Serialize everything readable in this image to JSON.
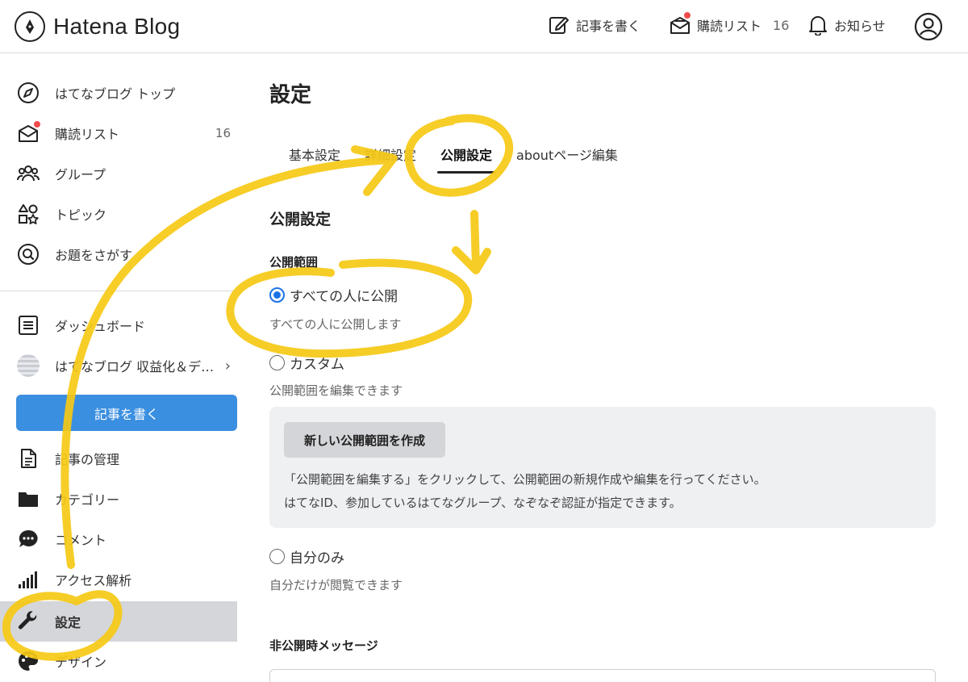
{
  "header": {
    "logo_text": "Hatena Blog",
    "write_label": "記事を書く",
    "reading_list_label": "購読リスト",
    "reading_list_count": "16",
    "notifications_label": "お知らせ"
  },
  "sidebar": {
    "top_items": [
      {
        "label": "はてなブログ トップ",
        "icon": "compass-icon"
      },
      {
        "label": "購読リスト",
        "icon": "reading-list-icon",
        "count": "16"
      },
      {
        "label": "グループ",
        "icon": "group-icon"
      },
      {
        "label": "トピック",
        "icon": "topic-icon"
      },
      {
        "label": "お題をさがす",
        "icon": "search-theme-icon"
      }
    ],
    "dashboard_label": "ダッシュボード",
    "blog_label": "はてなブログ 収益化＆デ…",
    "write_button": "記事を書く",
    "manage_items": [
      {
        "label": "記事の管理",
        "icon": "document-icon"
      },
      {
        "label": "カテゴリー",
        "icon": "folder-icon"
      },
      {
        "label": "コメント",
        "icon": "comment-icon"
      },
      {
        "label": "アクセス解析",
        "icon": "analytics-icon"
      },
      {
        "label": "設定",
        "icon": "wrench-icon",
        "active": true
      },
      {
        "label": "デザイン",
        "icon": "palette-icon"
      }
    ]
  },
  "main": {
    "title": "設定",
    "tabs": [
      {
        "label": "基本設定",
        "active": false
      },
      {
        "label": "詳細設定",
        "active": false
      },
      {
        "label": "公開設定",
        "active": true
      },
      {
        "label": "aboutページ編集",
        "active": false
      }
    ],
    "section_title": "公開設定",
    "visibility_label": "公開範囲",
    "options": [
      {
        "label": "すべての人に公開",
        "desc": "すべての人に公開します",
        "checked": true
      },
      {
        "label": "カスタム",
        "desc": "公開範囲を編集できます",
        "checked": false
      },
      {
        "label": "自分のみ",
        "desc": "自分だけが閲覧できます",
        "checked": false
      }
    ],
    "create_button": "新しい公開範囲を作成",
    "info_lines": [
      "「公開範囲を編集する」をクリックして、公開範囲の新規作成や編集を行ってください。",
      "はてなID、参加しているはてなグループ、なぞなぞ認証が指定できます。"
    ],
    "private_message_label": "非公開時メッセージ"
  },
  "colors": {
    "accent": "#3b8fe0",
    "radio_checked": "#1a73e8",
    "annotation": "#f6c915",
    "badge": "#f04b4b"
  }
}
